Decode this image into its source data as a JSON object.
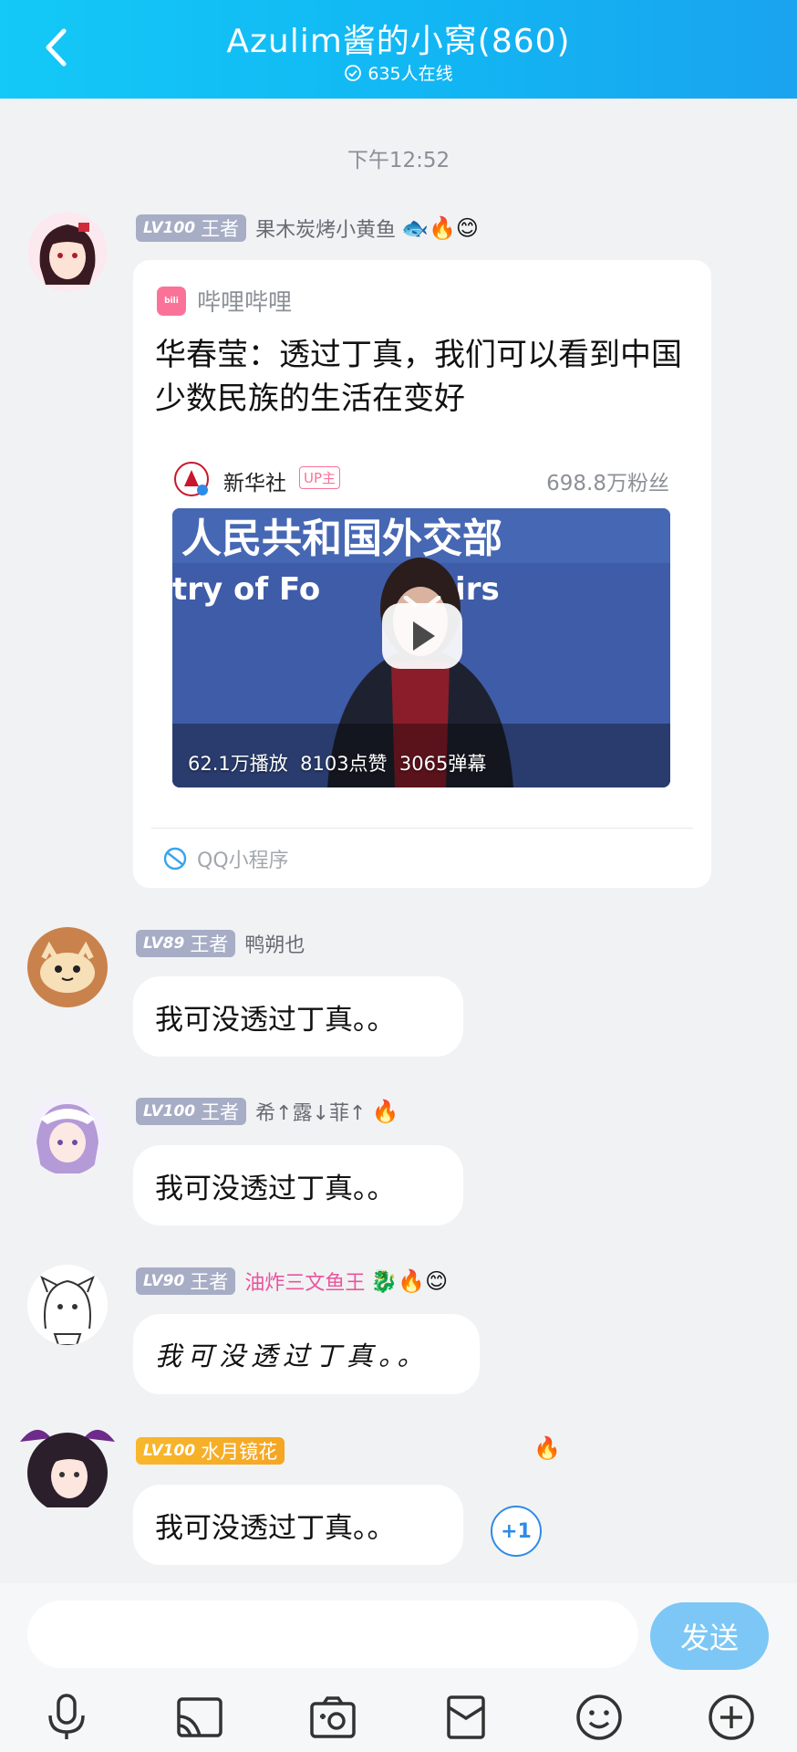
{
  "header": {
    "title": "Azulim酱的小窝(860)",
    "online": "635人在线"
  },
  "timestamp": "下午12:52",
  "messages": [
    {
      "level": "LV100",
      "rank": "王者",
      "nick": "果木炭烤小黄鱼",
      "emojis": "🐟🔥😊",
      "card": {
        "source": "哔哩哔哩",
        "title": "华春莹：透过丁真，我们可以看到中国少数民族的生活在变好",
        "uploader": "新华社",
        "up_tag": "UP主",
        "fans": "698.8万粉丝",
        "video_banner_cn": "人民共和国外交部",
        "video_banner_en": "try of Fo      Affairs",
        "stats": "62.1万播放  8103点赞  3065弹幕",
        "footer": "QQ小程序"
      }
    },
    {
      "level": "LV89",
      "rank": "王者",
      "nick": "鸭朔也",
      "emojis": "",
      "text": "我可没透过丁真。。"
    },
    {
      "level": "LV100",
      "rank": "王者",
      "nick": "希↑露↓菲↑",
      "emojis": "🔥",
      "text": "我可没透过丁真。。"
    },
    {
      "level": "LV90",
      "rank": "王者",
      "nick": "油炸三文鱼王",
      "emojis": "🐉🔥😊",
      "text": "我可没透过丁真。。"
    },
    {
      "level": "LV100",
      "rank": "水月镜花",
      "nick": "",
      "emojis": "🔥",
      "text": "我可没透过丁真。。",
      "plus": "+1"
    }
  ],
  "input": {
    "placeholder": "",
    "send": "发送"
  },
  "toolbar": [
    "mic-icon",
    "cast-icon",
    "camera-icon",
    "red-packet-icon",
    "emoji-icon",
    "plus-icon"
  ],
  "colors": {
    "header": "#13c9f7",
    "send": "#7cc7f5",
    "bilibili": "#fb7299"
  }
}
